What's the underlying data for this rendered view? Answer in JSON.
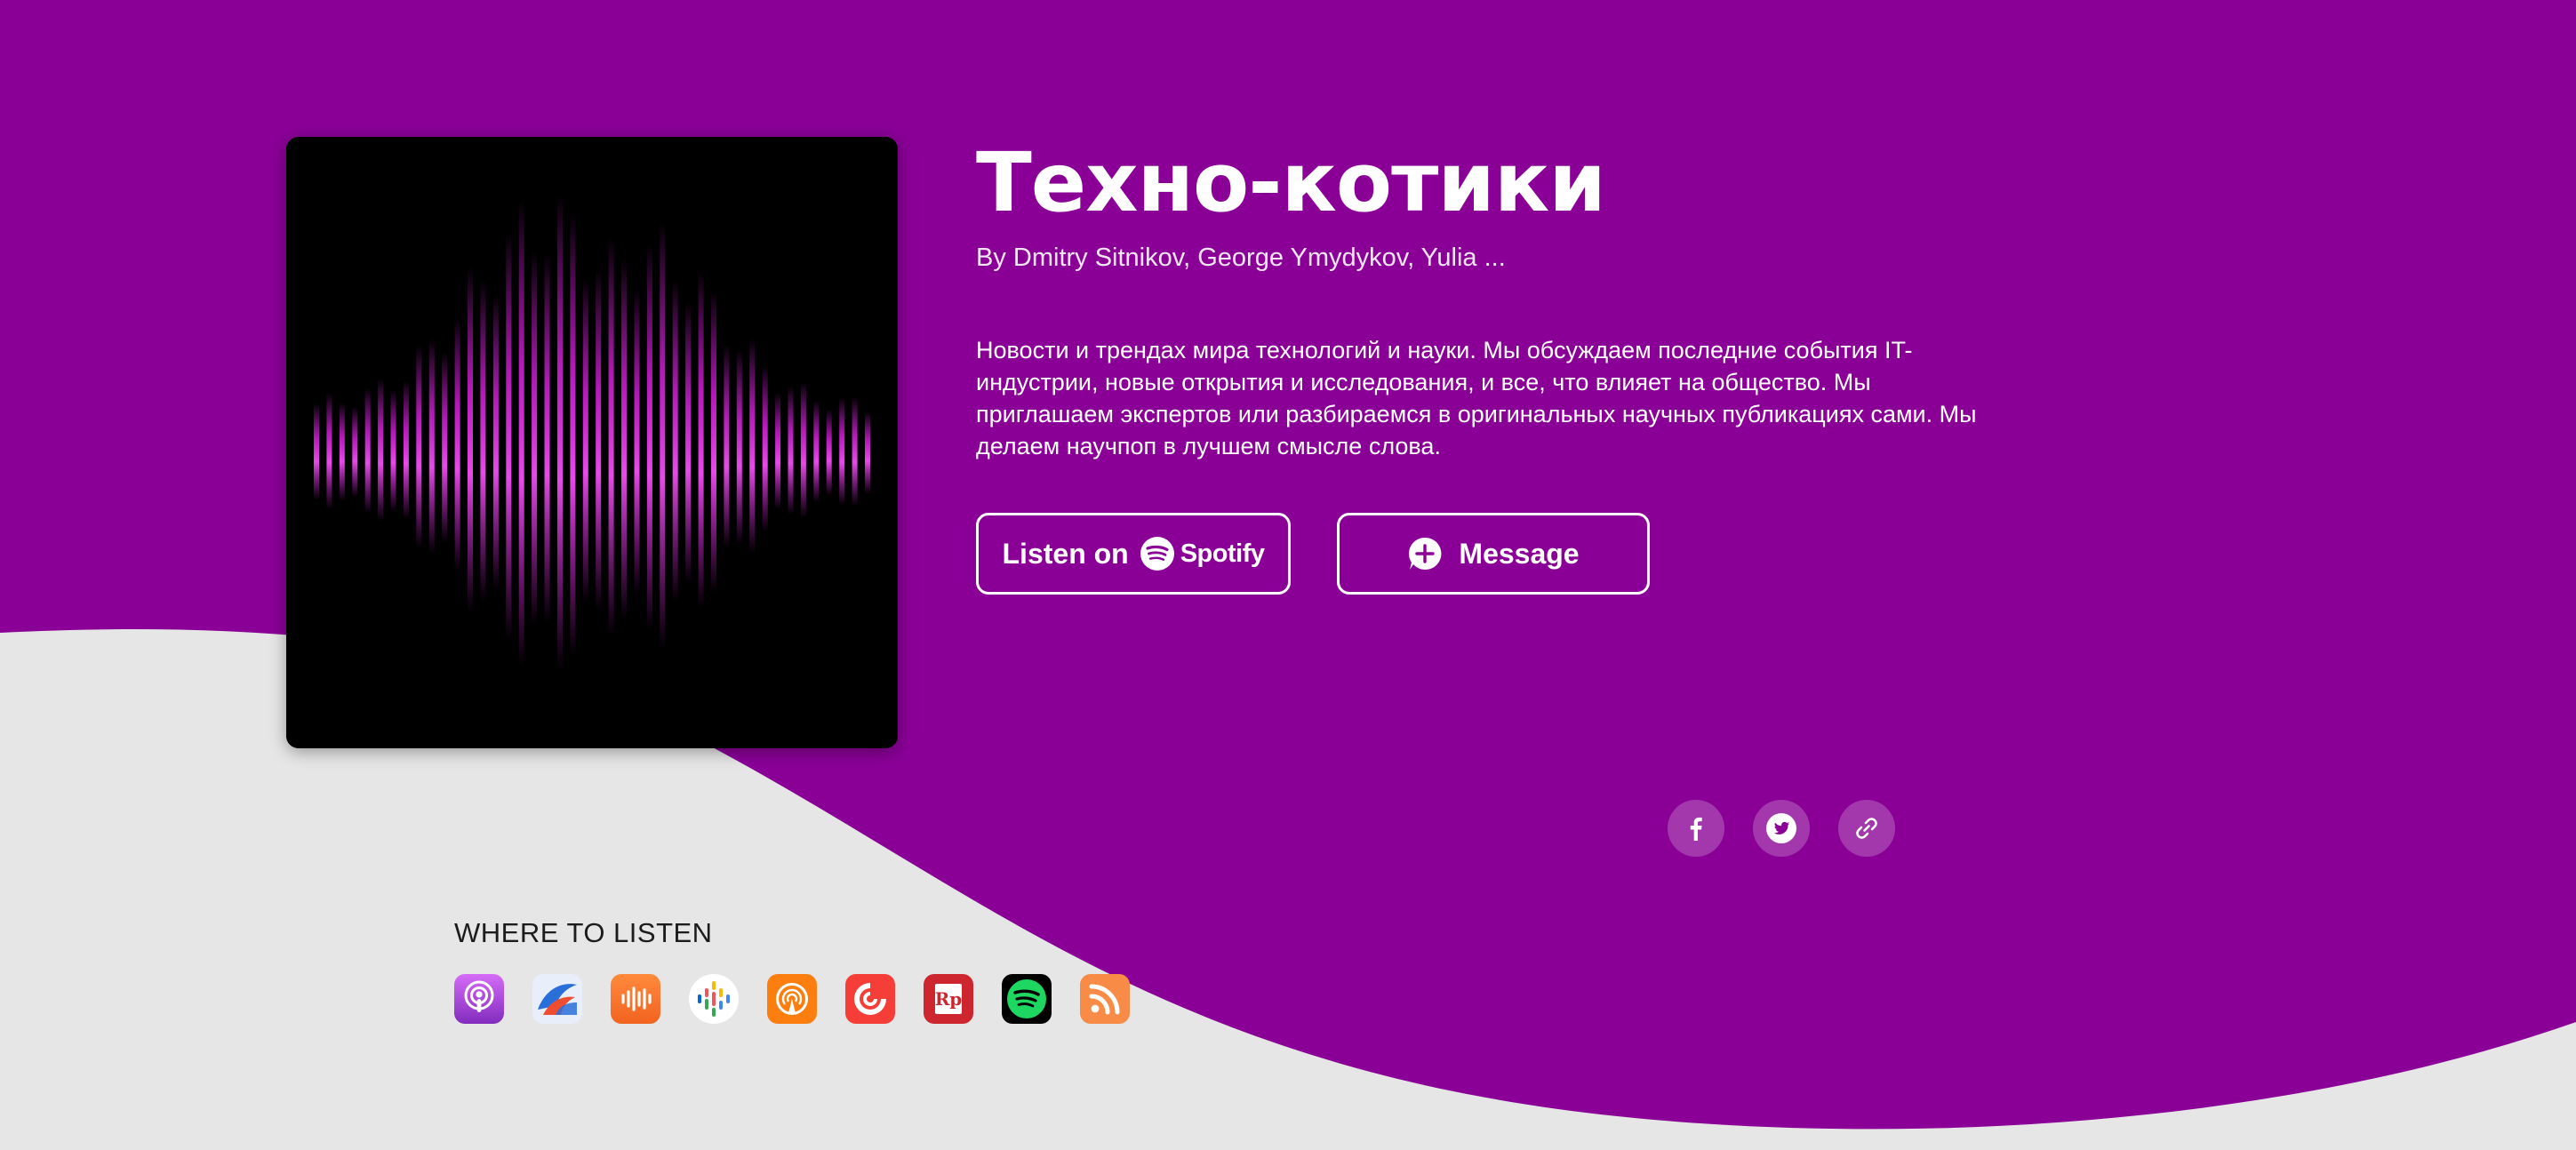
{
  "podcast": {
    "title": "Техно-котики",
    "authors": "By Dmitry Sitnikov, George Ymydykov, Yulia ...",
    "description": "Новости и трендах мира технологий и науки. Мы обсуждаем последние события IT-индустрии, новые открытия и исследования, и все, что влияет на общество. Мы приглашаем экспертов или разбираемся в оригинальных научных публикациях сами. Мы делаем научпоп в лучшем смысле слова."
  },
  "actions": {
    "listen_label": "Listen on",
    "spotify_label": "Spotify",
    "message_label": "Message"
  },
  "social": [
    "facebook-icon",
    "twitter-icon",
    "link-icon"
  ],
  "where_to_listen": {
    "title": "WHERE TO LISTEN",
    "platforms": [
      "apple-podcasts-icon",
      "castbox-icon",
      "castro-icon",
      "google-podcasts-icon",
      "overcast-icon",
      "pocket-casts-icon",
      "radio-public-icon",
      "spotify-icon",
      "rss-icon"
    ]
  },
  "colors": {
    "background_purple": "#8a0097",
    "wave_gray": "#e6e6e6",
    "cover_bars": "#d21fd8"
  }
}
